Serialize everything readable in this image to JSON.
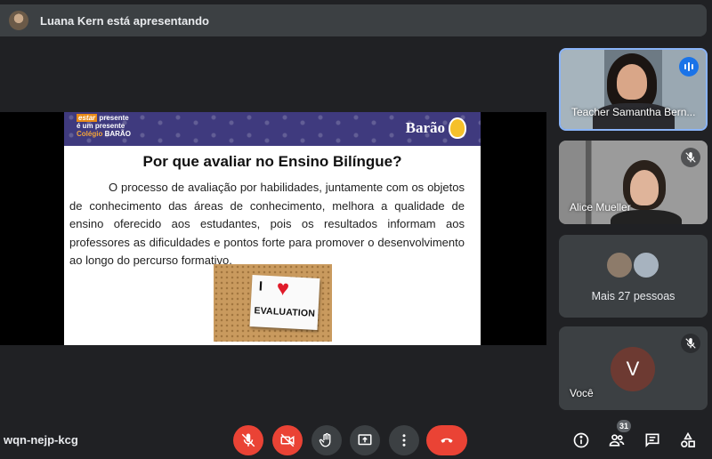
{
  "presentation_banner": {
    "text": "Luana Kern está apresentando"
  },
  "slide": {
    "header_left": {
      "line1_estar": "estar",
      "line1_rest": "presente",
      "line2": "é um presente",
      "line3": "Colégio",
      "line4": "BARÃO"
    },
    "header_right": {
      "name": "Barão"
    },
    "title": "Por que avaliar no Ensino Bilíngue?",
    "body": "O processo de avaliação por habilidades, juntamente com os objetos de conhecimento das áreas de conhecimento, melhora a qualidade de ensino oferecido aos estudantes, pois os resultados informam aos professores as dificuldades e pontos forte para promover o desenvolvimento ao longo do percurso formativo.",
    "image_card": {
      "text_i": "I",
      "text_word": "EVALUATION"
    }
  },
  "participants": [
    {
      "name": "Teacher Samantha Bern...",
      "status": "speaking"
    },
    {
      "name": "Alice Mueller",
      "status": "muted"
    }
  ],
  "others_tile": {
    "label": "Mais 27 pessoas"
  },
  "self_tile": {
    "name": "Você",
    "initial": "V",
    "status": "muted"
  },
  "meeting_code": "wqn-nejp-kcg",
  "controls": {
    "mic": "mic-off-icon",
    "camera": "camera-off-icon",
    "raise_hand": "hand-icon",
    "present": "present-icon",
    "more": "more-vert-icon",
    "end_call": "call-end-icon"
  },
  "right_controls": {
    "people_count": "31"
  },
  "colors": {
    "background": "#202124",
    "surface": "#3c4043",
    "danger": "#ea4335",
    "speaking": "#1a73e8",
    "self_avatar": "#6d3a32"
  }
}
